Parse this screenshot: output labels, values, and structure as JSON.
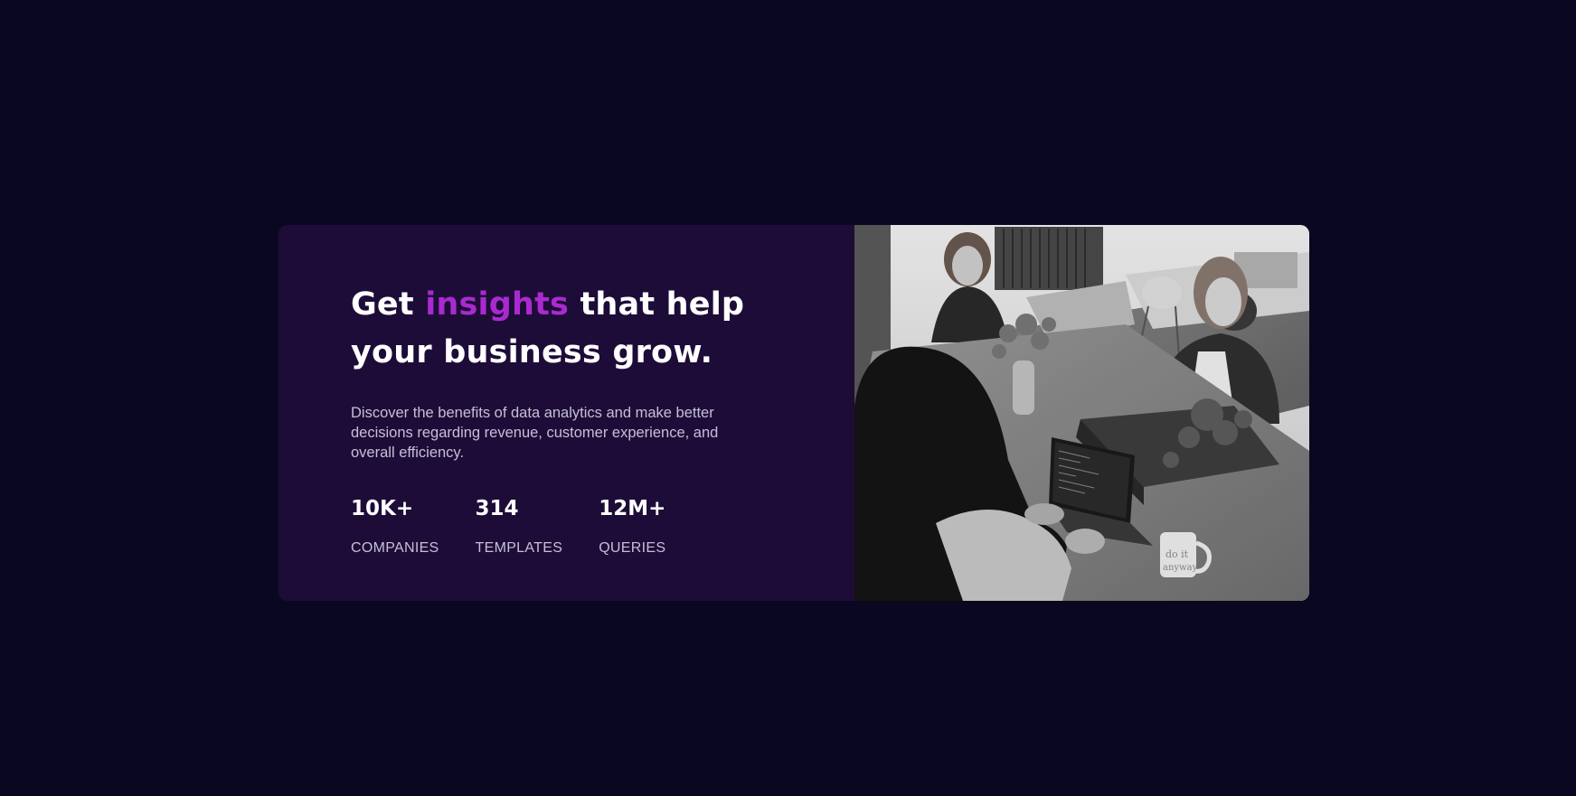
{
  "hero": {
    "headline_part1": "Get ",
    "headline_accent": "insights",
    "headline_part2": " that help your business grow.",
    "description": "Discover the benefits of data analytics and make better decisions regarding revenue, customer experience, and overall efficiency.",
    "accent_color": "#aa2ad0",
    "card_color": "#1d0c38",
    "page_color": "#0a0820"
  },
  "stats": [
    {
      "value": "10K+",
      "label": "COMPANIES"
    },
    {
      "value": "314",
      "label": "TEMPLATES"
    },
    {
      "value": "12M+",
      "label": "QUERIES"
    }
  ],
  "image": {
    "icon": "office-photo-image",
    "mug_text": "do it anyway"
  }
}
